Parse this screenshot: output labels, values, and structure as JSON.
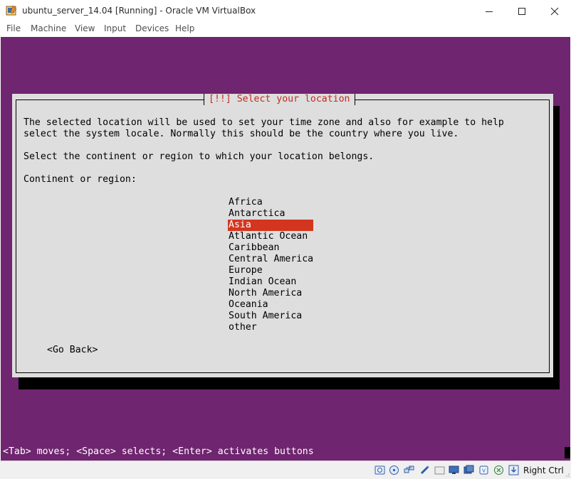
{
  "window": {
    "title": "ubuntu_server_14.04 [Running] - Oracle VM VirtualBox",
    "minimize_glyph": "—",
    "maximize_glyph": "☐",
    "close_glyph": "✕"
  },
  "menu": {
    "items": [
      "File",
      "Machine",
      "View",
      "Input",
      "Devices",
      "Help"
    ]
  },
  "installer": {
    "dialog_title": "[!!] Select your location",
    "description_line1": "The selected location will be used to set your time zone and also for example to help",
    "description_line2": "select the system locale. Normally this should be the country where you live.",
    "prompt": "Select the continent or region to which your location belongs.",
    "field_label": "Continent or region:",
    "regions": [
      "Africa",
      "Antarctica",
      "Asia",
      "Atlantic Ocean",
      "Caribbean",
      "Central America",
      "Europe",
      "Indian Ocean",
      "North America",
      "Oceania",
      "South America",
      "other"
    ],
    "selected_region": "Asia",
    "go_back": "<Go Back>",
    "help_line": "<Tab> moves; <Space> selects; <Enter> activates buttons"
  },
  "statusbar": {
    "host_key": "Right Ctrl",
    "icons": [
      "hard-disk-icon",
      "optical-drive-icon",
      "network-icon",
      "usb-icon",
      "shared-folders-icon",
      "display-icon",
      "video-capture-icon",
      "cpu-icon",
      "mouse-integration-icon",
      "keyboard-capture-icon"
    ]
  },
  "colors": {
    "console_background": "#6f256f",
    "dialog_background": "#dedede",
    "dialog_title": "#c42a21",
    "selection": "#d3351f"
  }
}
